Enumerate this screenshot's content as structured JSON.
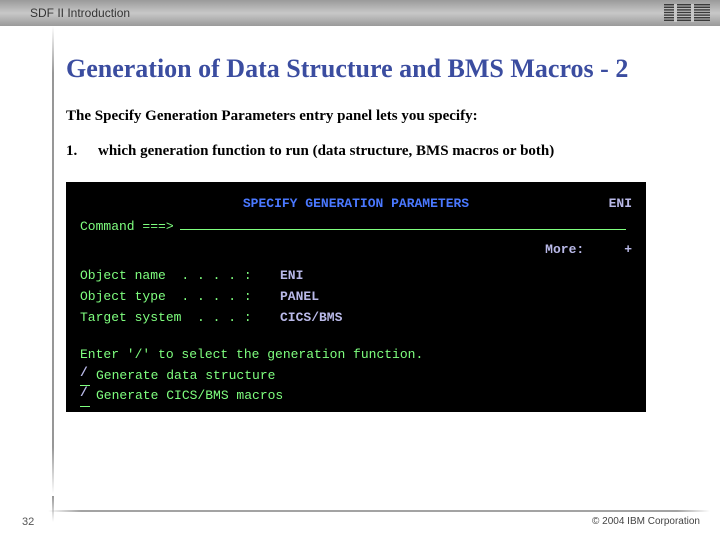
{
  "topbar": {
    "title": "SDF II  Introduction",
    "logo_alt": "IBM"
  },
  "slide": {
    "title": "Generation of Data Structure and BMS Macros - 2",
    "intro": "The Specify Generation Parameters entry panel lets you specify:",
    "items": [
      {
        "num": "1.",
        "text": "which generation function to run (data structure, BMS macros or both)"
      }
    ]
  },
  "terminal": {
    "header_center": "SPECIFY GENERATION PARAMETERS",
    "header_right": "ENI",
    "command_label": "Command ===>",
    "more_label": "More:",
    "more_indicator": "+",
    "fields": [
      {
        "label": "Object name  . . . . : ",
        "value": "ENI"
      },
      {
        "label": "Object type  . . . . : ",
        "value": "PANEL"
      },
      {
        "label": "Target system  . . . : ",
        "value": "CICS/BMS"
      }
    ],
    "prompt": "Enter '/' to select the generation function.",
    "checks": [
      {
        "mark": "/",
        "label": "Generate data structure"
      },
      {
        "mark": "/",
        "label": "Generate CICS/BMS macros"
      }
    ]
  },
  "footer": {
    "page": "32",
    "copyright": "© 2004 IBM Corporation"
  }
}
